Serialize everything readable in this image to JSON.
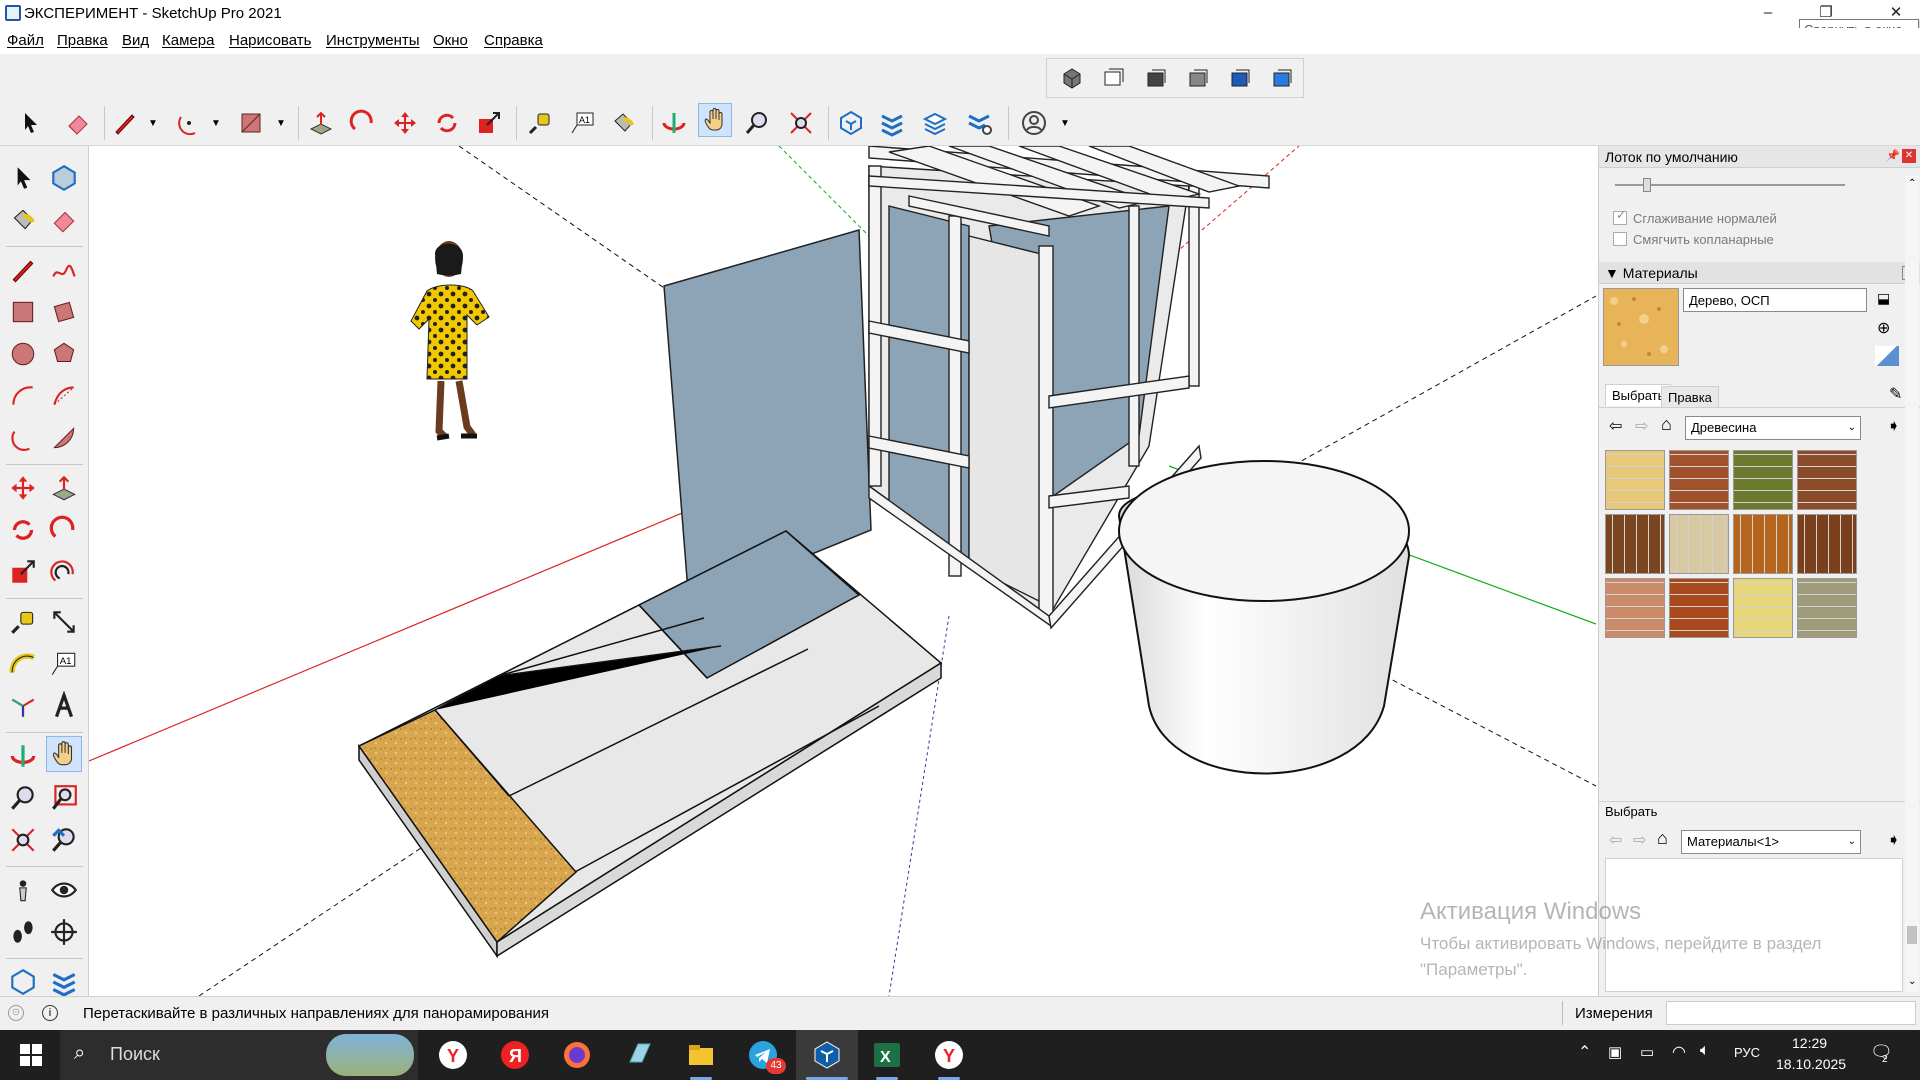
{
  "window": {
    "title": "ЭКСПЕРИМЕНТ - SketchUp Pro 2021",
    "tooltip": "Свернуть в окно",
    "controls": {
      "minimize": "–",
      "restore": "❐",
      "close": "✕"
    }
  },
  "menu": [
    "Файл",
    "Правка",
    "Вид",
    "Камера",
    "Нарисовать",
    "Инструменты",
    "Окно",
    "Справка"
  ],
  "tray": {
    "title": "Лоток по умолчанию",
    "options": [
      {
        "label": "Сглаживание нормалей",
        "checked": true
      },
      {
        "label": "Смягчить копланарные",
        "checked": false
      }
    ],
    "materials": {
      "header": "Материалы",
      "current_name": "Дерево, ОСП",
      "tabs": [
        "Выбрать",
        "Правка"
      ],
      "library": "Древесина",
      "swatch_colors": [
        "#e8c97a",
        "#a0522d",
        "#6b7a2e",
        "#8b4c2a",
        "#7a4420",
        "#d9c9a3",
        "#b5651d",
        "#7c3f1d",
        "#c98b6a",
        "#a84a1e",
        "#e8d77a",
        "#9e9c7a"
      ]
    },
    "select_panel": {
      "header": "Выбрать",
      "library": "Материалы<1>"
    },
    "watermark": {
      "title": "Активация Windows",
      "line1": "Чтобы активировать Windows, перейдите в раздел",
      "line2": "\"Параметры\"."
    }
  },
  "status": {
    "hint": "Перетаскивайте в различных направлениях для панорамирования",
    "measurements_label": "Измерения",
    "measurements_value": ""
  },
  "taskbar": {
    "search_placeholder": "Поиск",
    "telegram_badge": "43",
    "language": "РУС",
    "time": "12:29",
    "date": "18.10.2025",
    "notifications": "2"
  },
  "colors": {
    "accent": "#cfe3fb",
    "axis_red": "#d22",
    "axis_green": "#1a1",
    "axis_blue": "#33a",
    "osb": "#d6a24d",
    "glass": "#8da3b6"
  }
}
